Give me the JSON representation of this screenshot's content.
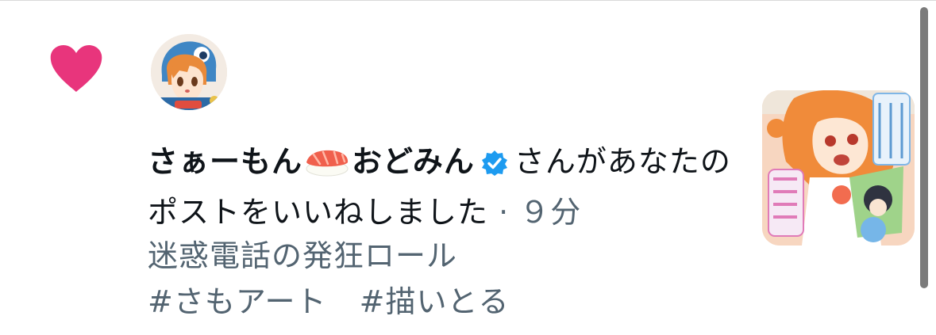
{
  "notification": {
    "icon": "heart-icon",
    "accent_color": "#e8357c",
    "user_name": "さぁーもん",
    "emoji": "sushi-emoji",
    "user_name_tail": "おどみん",
    "verified_badge": "verified-badge-icon",
    "verified_color": "#1d9bf0",
    "action_text": "さんがあなたのポストをいいねしました",
    "separator": " · ",
    "time": "９分"
  },
  "post": {
    "text": "迷惑電話の発狂ロール",
    "hashtags": [
      "#さもアート",
      "#描いとる"
    ]
  }
}
